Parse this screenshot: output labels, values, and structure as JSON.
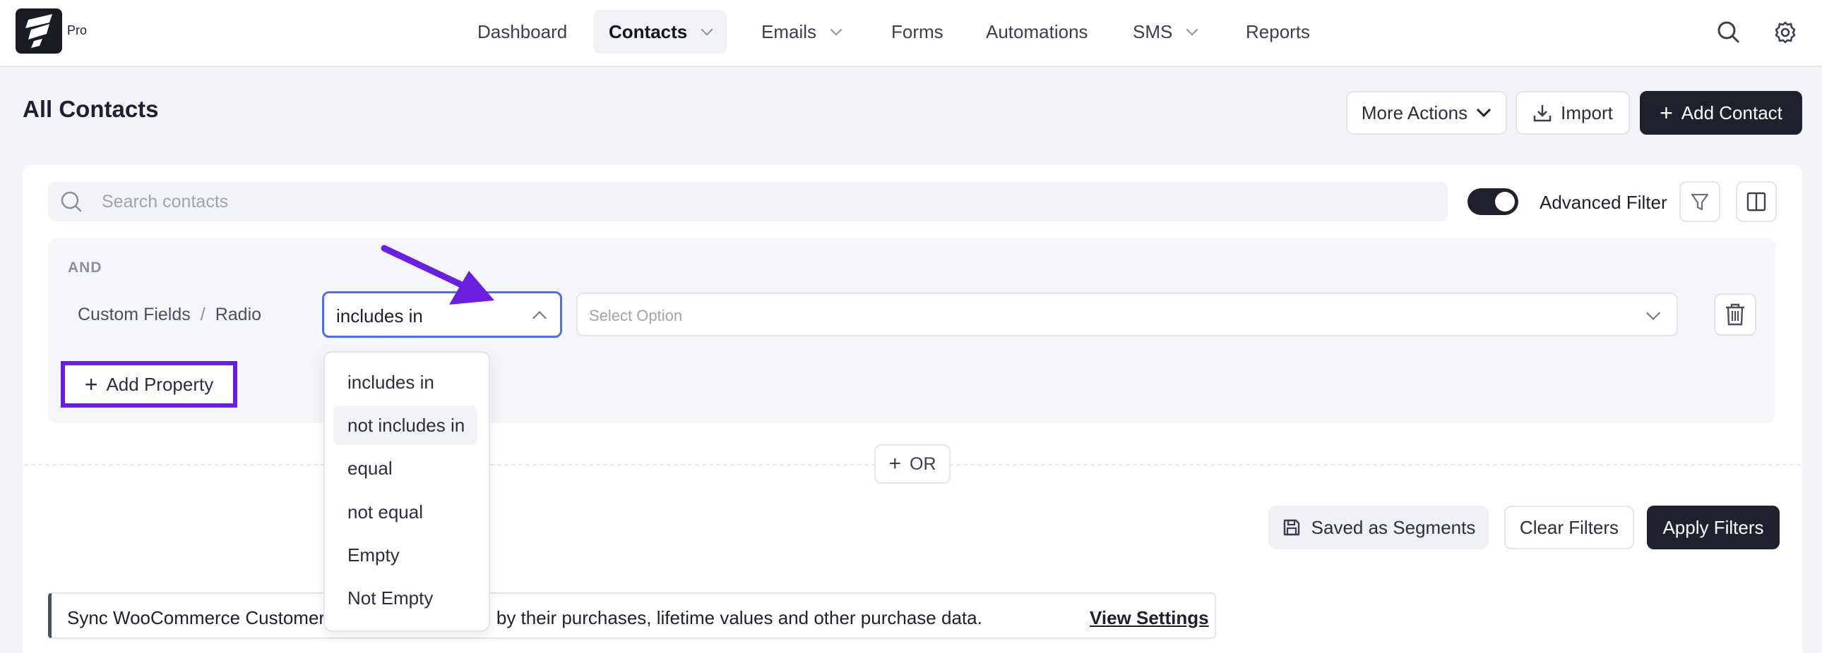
{
  "brand": {
    "badge": "Pro"
  },
  "nav": {
    "items": [
      {
        "label": "Dashboard",
        "active": false,
        "has_dropdown": false
      },
      {
        "label": "Contacts",
        "active": true,
        "has_dropdown": true
      },
      {
        "label": "Emails",
        "active": false,
        "has_dropdown": true
      },
      {
        "label": "Forms",
        "active": false,
        "has_dropdown": false
      },
      {
        "label": "Automations",
        "active": false,
        "has_dropdown": false
      },
      {
        "label": "SMS",
        "active": false,
        "has_dropdown": true
      },
      {
        "label": "Reports",
        "active": false,
        "has_dropdown": false
      }
    ],
    "icons": [
      "search-icon",
      "gear-icon"
    ]
  },
  "header": {
    "title": "All Contacts",
    "more_actions": "More Actions",
    "import": "Import",
    "add_contact": "Add Contact"
  },
  "search": {
    "placeholder": "Search contacts",
    "value": ""
  },
  "advanced_filter": {
    "label": "Advanced Filter",
    "enabled": true
  },
  "filter": {
    "group_label": "AND",
    "field_path": [
      "Custom Fields",
      "Radio"
    ],
    "operator": "includes in",
    "value_placeholder": "Select Option",
    "add_property": "Add Property",
    "or_label": "OR"
  },
  "operator_options": [
    {
      "label": "includes in"
    },
    {
      "label": "not includes in",
      "highlighted": true
    },
    {
      "label": "equal"
    },
    {
      "label": "not equal"
    },
    {
      "label": "Empty"
    },
    {
      "label": "Not Empty"
    }
  ],
  "actions": {
    "save_segments": "Saved as Segments",
    "clear_filters": "Clear Filters",
    "apply_filters": "Apply Filters"
  },
  "notice": {
    "text": "Sync WooCommerce Customers and segment them by their purchases, lifetime values and other purchase data.",
    "link": "View Settings"
  },
  "colors": {
    "accent_dark": "#1f222c",
    "focus_blue": "#4a6ff5",
    "annotation_purple": "#6a1ee0"
  }
}
